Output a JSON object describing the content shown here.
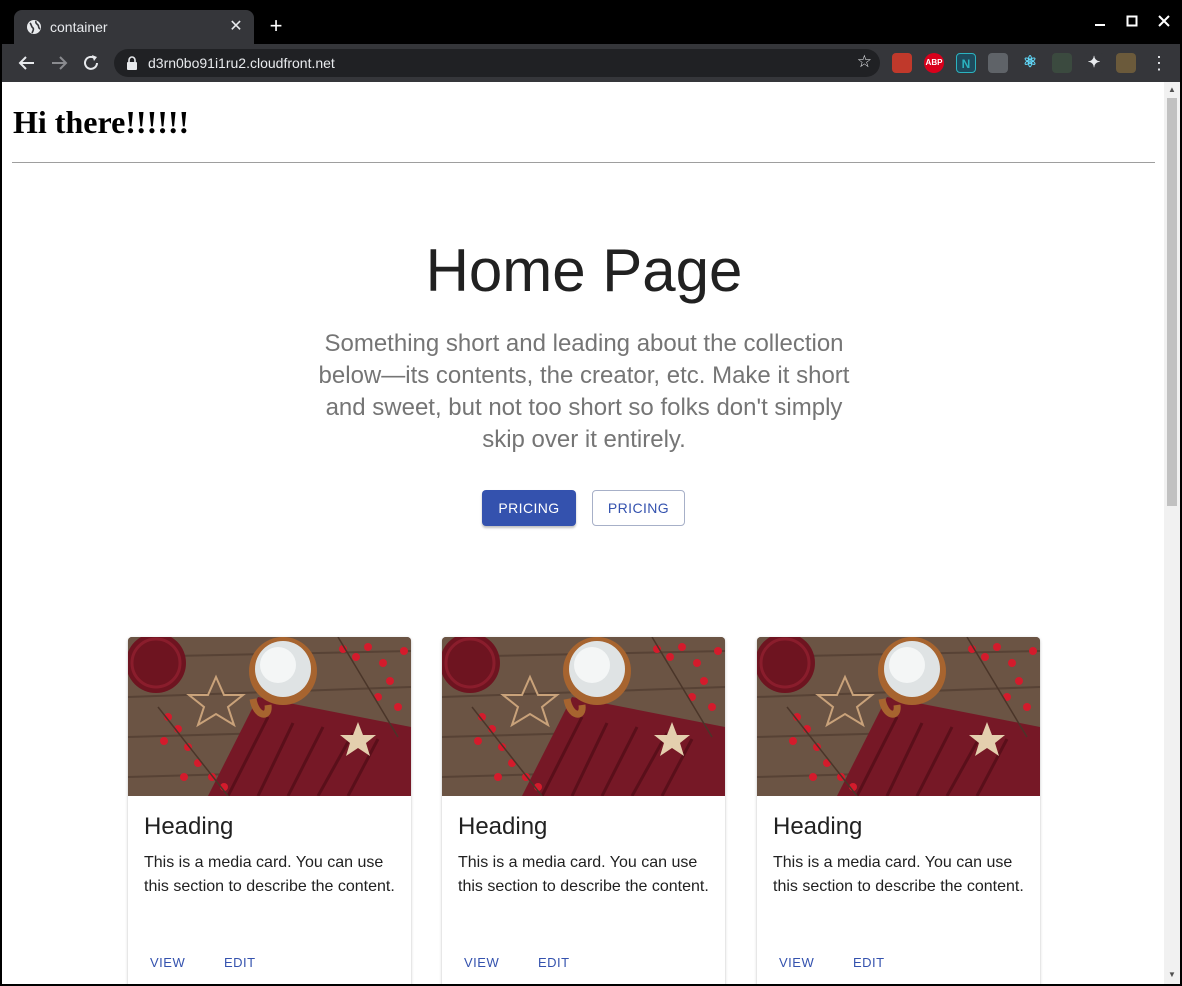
{
  "browser": {
    "tab_title": "container",
    "close_tab": "✕",
    "new_tab": "+",
    "url": "d3rn0bo91i1ru2.cloudfront.net",
    "window_controls": {
      "minimize": "—",
      "maximize": "☐",
      "close": "✕"
    },
    "extensions": [
      {
        "name": "santa-extension-icon",
        "label": "",
        "color": "#c0392b"
      },
      {
        "name": "adblock-plus-icon",
        "label": "ABP",
        "color": "#d9001b"
      },
      {
        "name": "n-extension-icon",
        "label": "N",
        "color": "#1e4a5c"
      },
      {
        "name": "cloud-extension-icon",
        "label": "",
        "color": "#5f6368"
      },
      {
        "name": "react-devtools-icon",
        "label": "",
        "color": "#35363a"
      },
      {
        "name": "tools-extension-icon",
        "label": "",
        "color": "#3b4a3f"
      },
      {
        "name": "puzzle-extensions-icon",
        "label": "",
        "color": "#35363a"
      },
      {
        "name": "profile-avatar-icon",
        "label": "",
        "color": "#6b5a3b"
      }
    ]
  },
  "page": {
    "greeting": "Hi there!!!!!!",
    "hero": {
      "title": "Home Page",
      "description": "Something short and leading about the collection below—its contents, the creator, etc. Make it short and sweet, but not too short so folks don't simply skip over it entirely.",
      "primary_button": "PRICING",
      "secondary_button": "PRICING"
    },
    "cards": [
      {
        "heading": "Heading",
        "text": "This is a media card. You can use this section to describe the content.",
        "view": "VIEW",
        "edit": "EDIT"
      },
      {
        "heading": "Heading",
        "text": "This is a media card. You can use this section to describe the content.",
        "view": "VIEW",
        "edit": "EDIT"
      },
      {
        "heading": "Heading",
        "text": "This is a media card. You can use this section to describe the content.",
        "view": "VIEW",
        "edit": "EDIT"
      }
    ]
  },
  "colors": {
    "accent": "#3452ae",
    "chrome_dark": "#202124",
    "chrome_toolbar": "#35363a"
  }
}
